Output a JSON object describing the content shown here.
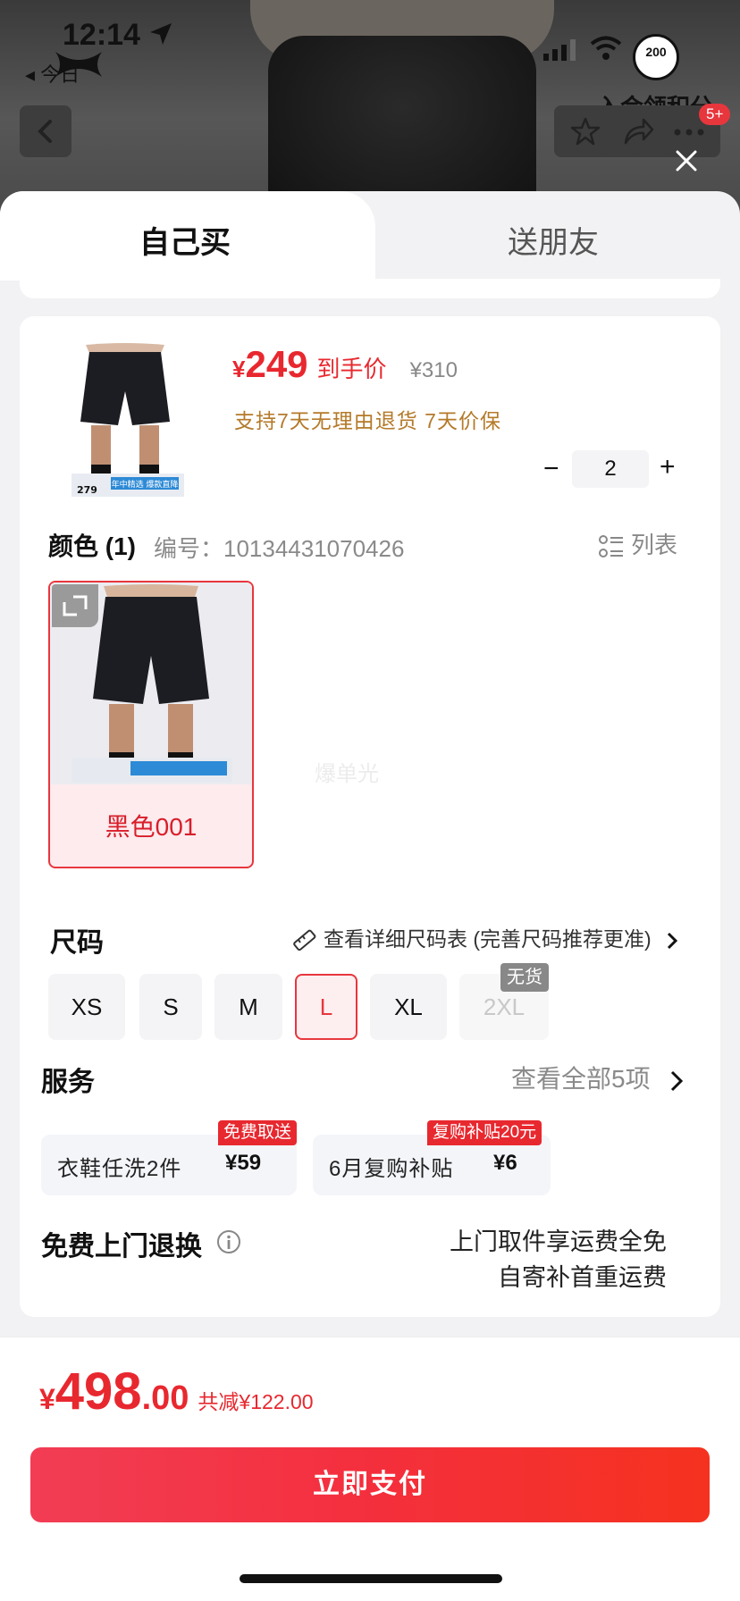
{
  "status": {
    "time": "12:14",
    "back_app": "◂ 今日",
    "circle_badge": "200",
    "join_text": "入会领积分",
    "notif_badge": "5+"
  },
  "tabs": [
    {
      "label": "自己买",
      "active": true
    },
    {
      "label": "送朋友",
      "active": false
    }
  ],
  "product": {
    "yen": "¥",
    "price": "249",
    "price_label": "到手价",
    "original_price": "¥310",
    "promise": "支持7天无理由退货  7天价保",
    "quantity": "2",
    "thumb_tag_text": "年中精选 爆款直降",
    "thumb_price": "279"
  },
  "color": {
    "title": "颜色 (1)",
    "code": "编号：10134431070426",
    "list_label": "列表",
    "options": [
      {
        "name": "黑色001",
        "selected": true
      }
    ],
    "watermark": "爆单光"
  },
  "size": {
    "title": "尺码",
    "chart_link": "查看详细尺码表 (完善尺码推荐更准)",
    "options": [
      {
        "label": "XS",
        "state": "normal"
      },
      {
        "label": "S",
        "state": "normal"
      },
      {
        "label": "M",
        "state": "normal"
      },
      {
        "label": "L",
        "state": "selected"
      },
      {
        "label": "XL",
        "state": "normal"
      },
      {
        "label": "2XL",
        "state": "disabled"
      }
    ],
    "out_of_stock": "无货"
  },
  "service": {
    "title": "服务",
    "view_all": "查看全部5项",
    "items": [
      {
        "name": "衣鞋任洗2件",
        "price": "¥59",
        "tag": "免费取送"
      },
      {
        "name": "6月复购补贴",
        "price": "¥6",
        "tag": "复购补贴20元"
      }
    ]
  },
  "return": {
    "title": "免费上门退换",
    "desc_line1": "上门取件享运费全免",
    "desc_line2": "自寄补首重运费"
  },
  "footer": {
    "yen": "¥",
    "total_int": "498",
    "total_dec": ".00",
    "savings": "共减¥122.00",
    "pay_button": "立即支付"
  },
  "colors": {
    "accent": "#e8282f",
    "promise": "#b47a2a",
    "button_gradient_start": "#f23d54",
    "button_gradient_end": "#f5321f"
  }
}
